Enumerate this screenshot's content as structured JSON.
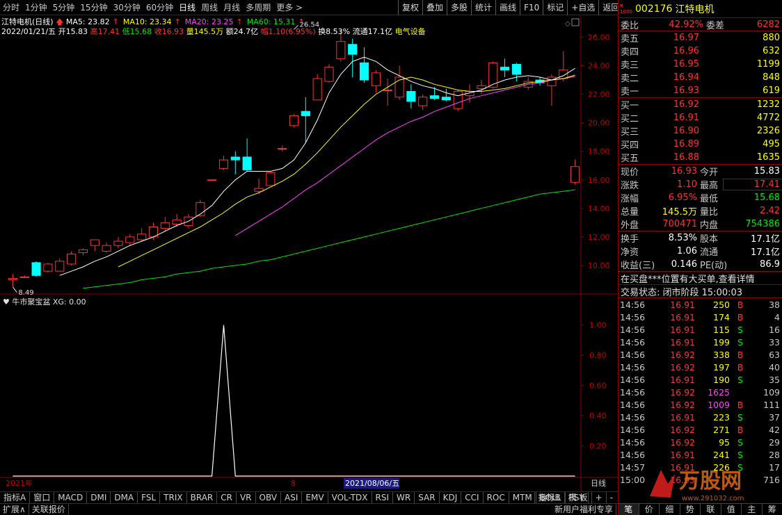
{
  "toolbar": {
    "periods": [
      "分时",
      "1分钟",
      "5分钟",
      "15分钟",
      "30分钟",
      "60分钟",
      "日线",
      "周线",
      "月线",
      "多周期",
      "更多 >"
    ],
    "active_period": "日线",
    "tools": [
      "复权",
      "叠加",
      "多股",
      "统计",
      "画线",
      "F10",
      "标记",
      "+自选",
      "返回"
    ]
  },
  "stock": {
    "name": "江特电机",
    "code": "002176",
    "period_label": "(日线)"
  },
  "ma_legend": [
    {
      "label": "MA5: 23.82",
      "color": "#ffffff"
    },
    {
      "label": "MA10: 23.34",
      "color": "#ffff00"
    },
    {
      "label": "MA20: 23.25",
      "color": "#ff40ff"
    },
    {
      "label": "MA60: 15.31",
      "color": "#00e600"
    }
  ],
  "bar_info": {
    "date": "2022/01/21/五",
    "open_label": "开",
    "open": "15.83",
    "high_label": "高",
    "high": "17.41",
    "low_label": "低",
    "low": "15.68",
    "close_label": "收",
    "close": "16.93",
    "vol_label": "量",
    "vol": "145.5万",
    "amount_label": "额",
    "amount": "24.7亿",
    "range_label": "幅",
    "range": "1.10(6.95%)",
    "turnover": "换8.53%",
    "float": "流通17.1亿",
    "sector": "电气设备"
  },
  "indicator": {
    "name": "牛市聚宝盆",
    "value_label": "XG: 0.00"
  },
  "chart_data": [
    {
      "type": "candlestick",
      "ylim": [
        8.0,
        27.0
      ],
      "y_ticks": [
        10.0,
        12.0,
        14.0,
        16.0,
        18.0,
        20.0,
        22.0,
        24.0,
        26.0
      ],
      "annotations": [
        {
          "label": "26.54",
          "value": 26.54,
          "index": 24
        },
        {
          "label": "8.49",
          "value": 8.49,
          "index": 0
        }
      ],
      "candles": [
        [
          9.0,
          9.4,
          8.5,
          9.1
        ],
        [
          9.2,
          9.3,
          9.1,
          9.2
        ],
        [
          10.2,
          10.3,
          9.2,
          9.3
        ],
        [
          9.6,
          10.2,
          9.5,
          10.1
        ],
        [
          9.6,
          10.5,
          9.6,
          10.3
        ],
        [
          10.1,
          11.0,
          10.0,
          10.8
        ],
        [
          10.9,
          11.2,
          10.7,
          11.1
        ],
        [
          11.4,
          11.8,
          11.0,
          11.8
        ],
        [
          11.0,
          11.6,
          10.9,
          11.4
        ],
        [
          11.4,
          12.0,
          11.2,
          11.7
        ],
        [
          11.6,
          12.2,
          11.4,
          12.0
        ],
        [
          11.8,
          12.6,
          11.7,
          12.2
        ],
        [
          12.0,
          13.0,
          11.8,
          12.7
        ],
        [
          12.6,
          13.4,
          12.4,
          13.0
        ],
        [
          12.9,
          13.6,
          12.7,
          13.2
        ],
        [
          12.8,
          13.6,
          12.6,
          13.4
        ],
        [
          13.5,
          14.6,
          13.4,
          14.4
        ],
        [
          16.0,
          16.0,
          16.0,
          16.0
        ],
        [
          16.8,
          17.7,
          16.7,
          17.4
        ],
        [
          17.6,
          18.0,
          16.4,
          17.4
        ],
        [
          17.6,
          18.9,
          16.6,
          16.7
        ],
        [
          15.2,
          16.1,
          15.0,
          15.4
        ],
        [
          15.6,
          16.6,
          15.6,
          16.5
        ],
        [
          18.2,
          18.4,
          18.0,
          18.2
        ],
        [
          19.8,
          20.6,
          19.7,
          20.5
        ],
        [
          20.8,
          21.8,
          18.6,
          20.5
        ],
        [
          21.6,
          23.4,
          21.6,
          23.1
        ],
        [
          22.9,
          24.1,
          22.8,
          23.9
        ],
        [
          24.5,
          26.54,
          24.3,
          25.7
        ],
        [
          25.5,
          25.9,
          23.2,
          24.8
        ],
        [
          24.2,
          25.3,
          22.8,
          23.0
        ],
        [
          22.6,
          23.7,
          22.1,
          23.5
        ],
        [
          22.3,
          23.1,
          21.2,
          22.3
        ],
        [
          21.8,
          24.0,
          21.6,
          23.2
        ],
        [
          22.2,
          22.7,
          21.0,
          21.5
        ],
        [
          21.2,
          22.0,
          20.9,
          21.8
        ],
        [
          21.9,
          22.5,
          21.6,
          21.7
        ],
        [
          21.8,
          22.4,
          21.5,
          21.6
        ],
        [
          21.0,
          22.3,
          20.8,
          22.2
        ],
        [
          21.9,
          22.7,
          21.4,
          22.2
        ],
        [
          22.4,
          23.0,
          22.0,
          22.6
        ],
        [
          22.5,
          24.3,
          22.4,
          24.2
        ],
        [
          23.9,
          24.5,
          23.2,
          23.7
        ],
        [
          24.1,
          24.2,
          22.9,
          23.4
        ],
        [
          22.5,
          23.2,
          22.3,
          22.9
        ],
        [
          23.0,
          23.2,
          22.6,
          22.8
        ],
        [
          22.6,
          23.4,
          21.2,
          23.2
        ],
        [
          23.1,
          25.0,
          22.9,
          23.7
        ],
        [
          15.83,
          17.41,
          15.68,
          16.93
        ]
      ],
      "ma5": [
        null,
        null,
        null,
        null,
        9.3,
        9.6,
        9.9,
        10.3,
        10.6,
        11.0,
        11.4,
        11.7,
        12.0,
        12.4,
        12.8,
        13.1,
        13.6,
        14.2,
        15.2,
        16.0,
        16.6,
        16.6,
        16.6,
        16.8,
        17.4,
        18.6,
        20.2,
        22.1,
        23.4,
        24.3,
        24.6,
        24.3,
        23.7,
        23.3,
        22.9,
        22.6,
        22.4,
        22.1,
        21.9,
        22.1,
        22.3,
        22.7,
        23.0,
        23.2,
        23.3,
        23.2,
        23.0,
        23.3,
        23.82
      ],
      "ma10": [
        null,
        null,
        null,
        null,
        null,
        null,
        null,
        null,
        null,
        9.9,
        10.3,
        10.7,
        11.1,
        11.5,
        11.9,
        12.3,
        12.7,
        13.2,
        13.7,
        14.3,
        14.8,
        15.1,
        15.5,
        15.9,
        16.4,
        17.1,
        17.9,
        18.8,
        19.7,
        20.5,
        21.3,
        22.0,
        22.5,
        23.0,
        23.2,
        23.0,
        22.7,
        22.5,
        22.3,
        22.2,
        22.2,
        22.3,
        22.4,
        22.6,
        22.8,
        22.9,
        23.0,
        23.1,
        23.34
      ],
      "ma20": [
        null,
        null,
        null,
        null,
        null,
        null,
        null,
        null,
        null,
        null,
        null,
        null,
        null,
        null,
        null,
        null,
        null,
        null,
        null,
        12.1,
        12.6,
        13.1,
        13.6,
        14.1,
        14.7,
        15.3,
        15.8,
        16.4,
        17.0,
        17.6,
        18.2,
        18.8,
        19.3,
        19.7,
        20.1,
        20.4,
        20.8,
        21.1,
        21.4,
        21.7,
        21.9,
        22.1,
        22.3,
        22.5,
        22.7,
        22.8,
        23.0,
        23.1,
        23.25
      ],
      "ma60": [
        null,
        null,
        null,
        null,
        null,
        null,
        8.4,
        8.5,
        8.6,
        8.7,
        8.8,
        9.0,
        9.1,
        9.2,
        9.4,
        9.5,
        9.6,
        9.8,
        9.9,
        10.0,
        10.1,
        10.3,
        10.4,
        10.6,
        10.8,
        11.0,
        11.2,
        11.4,
        11.6,
        11.8,
        12.0,
        12.2,
        12.4,
        12.6,
        12.8,
        13.0,
        13.2,
        13.4,
        13.6,
        13.8,
        14.0,
        14.2,
        14.4,
        14.6,
        14.8,
        15.0,
        15.1,
        15.2,
        15.31
      ]
    },
    {
      "type": "line",
      "name": "XG",
      "ylim": [
        0,
        1.1
      ],
      "y_ticks": [
        0.2,
        0.4,
        0.6,
        0.8,
        1.0
      ],
      "y_tick_labels": [
        "0.20",
        "0.40",
        "0.60",
        "0.80",
        "1.00"
      ],
      "values": [
        0,
        0,
        0,
        0,
        0,
        0,
        0,
        0,
        0,
        0,
        0,
        0,
        0,
        0,
        0,
        0,
        0,
        0,
        1,
        0,
        0,
        0,
        0,
        0,
        0,
        0,
        0,
        0,
        0,
        0,
        0,
        0,
        0,
        0,
        0,
        0,
        0,
        0,
        0,
        0,
        0,
        0,
        0,
        0,
        0,
        0,
        0,
        0,
        0
      ]
    }
  ],
  "date_axis": {
    "left": "2021年",
    "mid": "8",
    "cursor": "2021/08/06/五",
    "right": "日线"
  },
  "panel": {
    "webi_label": "委比",
    "webi": "42.92%",
    "wecha_label": "委差",
    "wecha": "6282",
    "asks": [
      {
        "label": "卖五",
        "price": "16.97",
        "vol": "880"
      },
      {
        "label": "卖四",
        "price": "16.96",
        "vol": "632"
      },
      {
        "label": "卖三",
        "price": "16.95",
        "vol": "1199"
      },
      {
        "label": "卖二",
        "price": "16.94",
        "vol": "848"
      },
      {
        "label": "卖一",
        "price": "16.93",
        "vol": "619"
      }
    ],
    "bids": [
      {
        "label": "买一",
        "price": "16.92",
        "vol": "1232"
      },
      {
        "label": "买二",
        "price": "16.91",
        "vol": "4772"
      },
      {
        "label": "买三",
        "price": "16.90",
        "vol": "2326"
      },
      {
        "label": "买四",
        "price": "16.89",
        "vol": "495"
      },
      {
        "label": "买五",
        "price": "16.88",
        "vol": "1635"
      }
    ],
    "quote": [
      {
        "l1": "现价",
        "v1": "16.93",
        "c1": "red",
        "l2": "今开",
        "v2": "15.83",
        "c2": "white"
      },
      {
        "l1": "涨跌",
        "v1": "1.10",
        "c1": "red",
        "l2": "最高",
        "v2": "17.41",
        "c2": "red"
      },
      {
        "l1": "涨幅",
        "v1": "6.95%",
        "c1": "red",
        "l2": "最低",
        "v2": "15.68",
        "c2": "green"
      },
      {
        "l1": "总量",
        "v1": "145.5万",
        "c1": "yellow",
        "l2": "量比",
        "v2": "2.42",
        "c2": "red"
      },
      {
        "l1": "外盘",
        "v1": "700471",
        "c1": "red",
        "l2": "内盘",
        "v2": "754386",
        "c2": "green"
      }
    ],
    "fund": [
      {
        "l1": "换手",
        "v1": "8.53%",
        "l2": "股本",
        "v2": "17.1亿"
      },
      {
        "l1": "净资",
        "v1": "1.06",
        "l2": "流通",
        "v2": "17.1亿"
      },
      {
        "l1": "收益(三)",
        "v1": "0.146",
        "l2": "PE(动)",
        "v2": "86.9"
      }
    ],
    "notice": "在买盘***位置有大买单,查看详情",
    "status": "交易状态: 闭市阶段  15:00:03",
    "ticks": [
      {
        "t": "14:56",
        "p": "16.91",
        "q": "250",
        "qc": "yellow",
        "d": "B",
        "dc": "red",
        "n": "38"
      },
      {
        "t": "14:56",
        "p": "16.91",
        "q": "174",
        "qc": "yellow",
        "d": "B",
        "dc": "red",
        "n": "4"
      },
      {
        "t": "14:56",
        "p": "16.91",
        "q": "115",
        "qc": "yellow",
        "d": "S",
        "dc": "green",
        "n": "16"
      },
      {
        "t": "14:56",
        "p": "16.91",
        "q": "199",
        "qc": "yellow",
        "d": "S",
        "dc": "green",
        "n": "33"
      },
      {
        "t": "14:56",
        "p": "16.92",
        "q": "338",
        "qc": "yellow",
        "d": "B",
        "dc": "red",
        "n": "63"
      },
      {
        "t": "14:56",
        "p": "16.92",
        "q": "197",
        "qc": "yellow",
        "d": "B",
        "dc": "red",
        "n": "40"
      },
      {
        "t": "14:56",
        "p": "16.91",
        "q": "190",
        "qc": "yellow",
        "d": "S",
        "dc": "green",
        "n": "35"
      },
      {
        "t": "14:56",
        "p": "16.92",
        "q": "1625",
        "qc": "magenta",
        "d": "",
        "dc": "red",
        "n": "109"
      },
      {
        "t": "14:56",
        "p": "16.92",
        "q": "1009",
        "qc": "magenta",
        "d": "B",
        "dc": "red",
        "n": "111"
      },
      {
        "t": "14:56",
        "p": "16.91",
        "q": "223",
        "qc": "yellow",
        "d": "S",
        "dc": "green",
        "n": "37"
      },
      {
        "t": "14:56",
        "p": "16.92",
        "q": "271",
        "qc": "yellow",
        "d": "B",
        "dc": "red",
        "n": "42"
      },
      {
        "t": "14:56",
        "p": "16.92",
        "q": "95",
        "qc": "yellow",
        "d": "S",
        "dc": "green",
        "n": "29"
      },
      {
        "t": "14:56",
        "p": "16.91",
        "q": "241",
        "qc": "yellow",
        "d": "S",
        "dc": "green",
        "n": "28"
      },
      {
        "t": "14:57",
        "p": "16.91",
        "q": "226",
        "qc": "yellow",
        "d": "S",
        "dc": "green",
        "n": "17"
      },
      {
        "t": "15:00",
        "p": "16.93",
        "q": "",
        "qc": "yellow",
        "d": "",
        "dc": "red",
        "n": "716"
      }
    ],
    "tabs": [
      "笔",
      "价",
      "细",
      "势",
      "联",
      "值",
      "主",
      "筹"
    ]
  },
  "bottom": {
    "tabs1": [
      "指标A",
      "窗口",
      "MACD",
      "DMI",
      "DMA",
      "FSL",
      "TRIX",
      "BRAR",
      "CR",
      "VR",
      "OBV",
      "ASI",
      "EMV",
      "VOL-TDX",
      "RSI",
      "WR",
      "SAR",
      "KDJ",
      "CCI",
      "ROC",
      "MTM",
      "BOLL",
      "PSY"
    ],
    "tabs1_right": [
      "指标B",
      "模 板",
      "+",
      "-"
    ],
    "tabs2": [
      "扩展∧",
      "关联报价"
    ],
    "tabs2_right": "新用户福利专享"
  },
  "watermark": {
    "brand": "万股网",
    "url": "www.291032.com"
  },
  "colors": {
    "up": "#ff3030",
    "down": "#00ffff",
    "ma5": "#ffffff",
    "ma10": "#ffff00",
    "ma20": "#ff40ff",
    "ma60": "#00e600",
    "border": "#8b0000"
  }
}
